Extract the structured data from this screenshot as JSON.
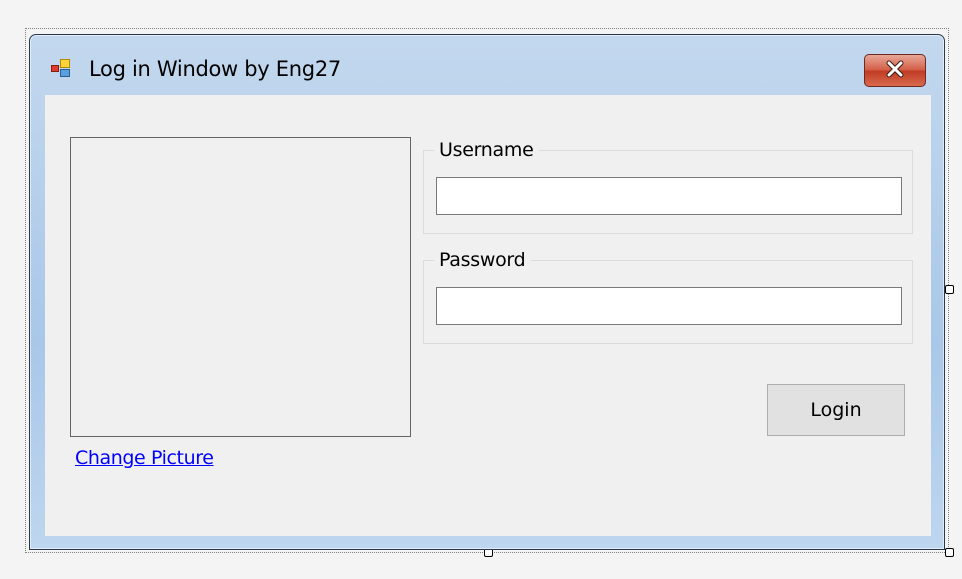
{
  "window": {
    "title": "Log in Window by Eng27",
    "icon": "windows-form-icon",
    "close_icon": "close-icon"
  },
  "picture": {
    "change_link": "Change Picture"
  },
  "username": {
    "label": "Username",
    "value": "",
    "placeholder": ""
  },
  "password": {
    "label": "Password",
    "value": "",
    "placeholder": ""
  },
  "login_button": {
    "label": "Login"
  },
  "colors": {
    "close_button": "#c74b33",
    "link": "#0000ff",
    "client_background": "#f0f0f0",
    "title_bar": "#b5cfec"
  }
}
